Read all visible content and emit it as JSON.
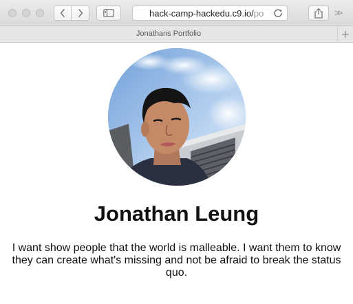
{
  "browser": {
    "url_visible": "hack-camp-hackedu.c9.io/",
    "url_faded": "po",
    "tab_title": "Jonathans Portfolio"
  },
  "icons": {
    "back": "chevron-left-icon",
    "forward": "chevron-right-icon",
    "sidebar": "sidebar-icon",
    "reload": "reload-icon",
    "share": "share-icon",
    "more": "double-chevron-icon",
    "new_tab": "plus-icon"
  },
  "profile": {
    "name": "Jonathan Leung",
    "bio": "I want show people that the world is malleable. I want them to know they can create what's missing and not be afraid to break the status quo."
  }
}
